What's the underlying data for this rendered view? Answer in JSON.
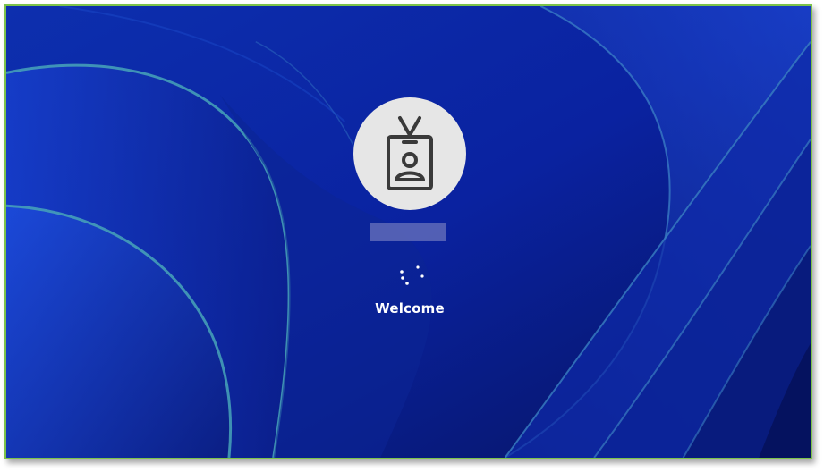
{
  "screen": {
    "welcome_text": "Welcome",
    "avatar_icon": "id-badge-icon",
    "spinner_icon": "loading-spinner-icon"
  },
  "colors": {
    "background_deep": "#0a1a7a",
    "background_mid": "#1336c4",
    "ribbon_edge": "#3d8fb0",
    "avatar_bg": "#e6e6e6",
    "icon_stroke": "#3a3a3a",
    "frame_border": "#7cc24a",
    "username_placeholder": "#5f6ab8",
    "text": "#ffffff"
  }
}
